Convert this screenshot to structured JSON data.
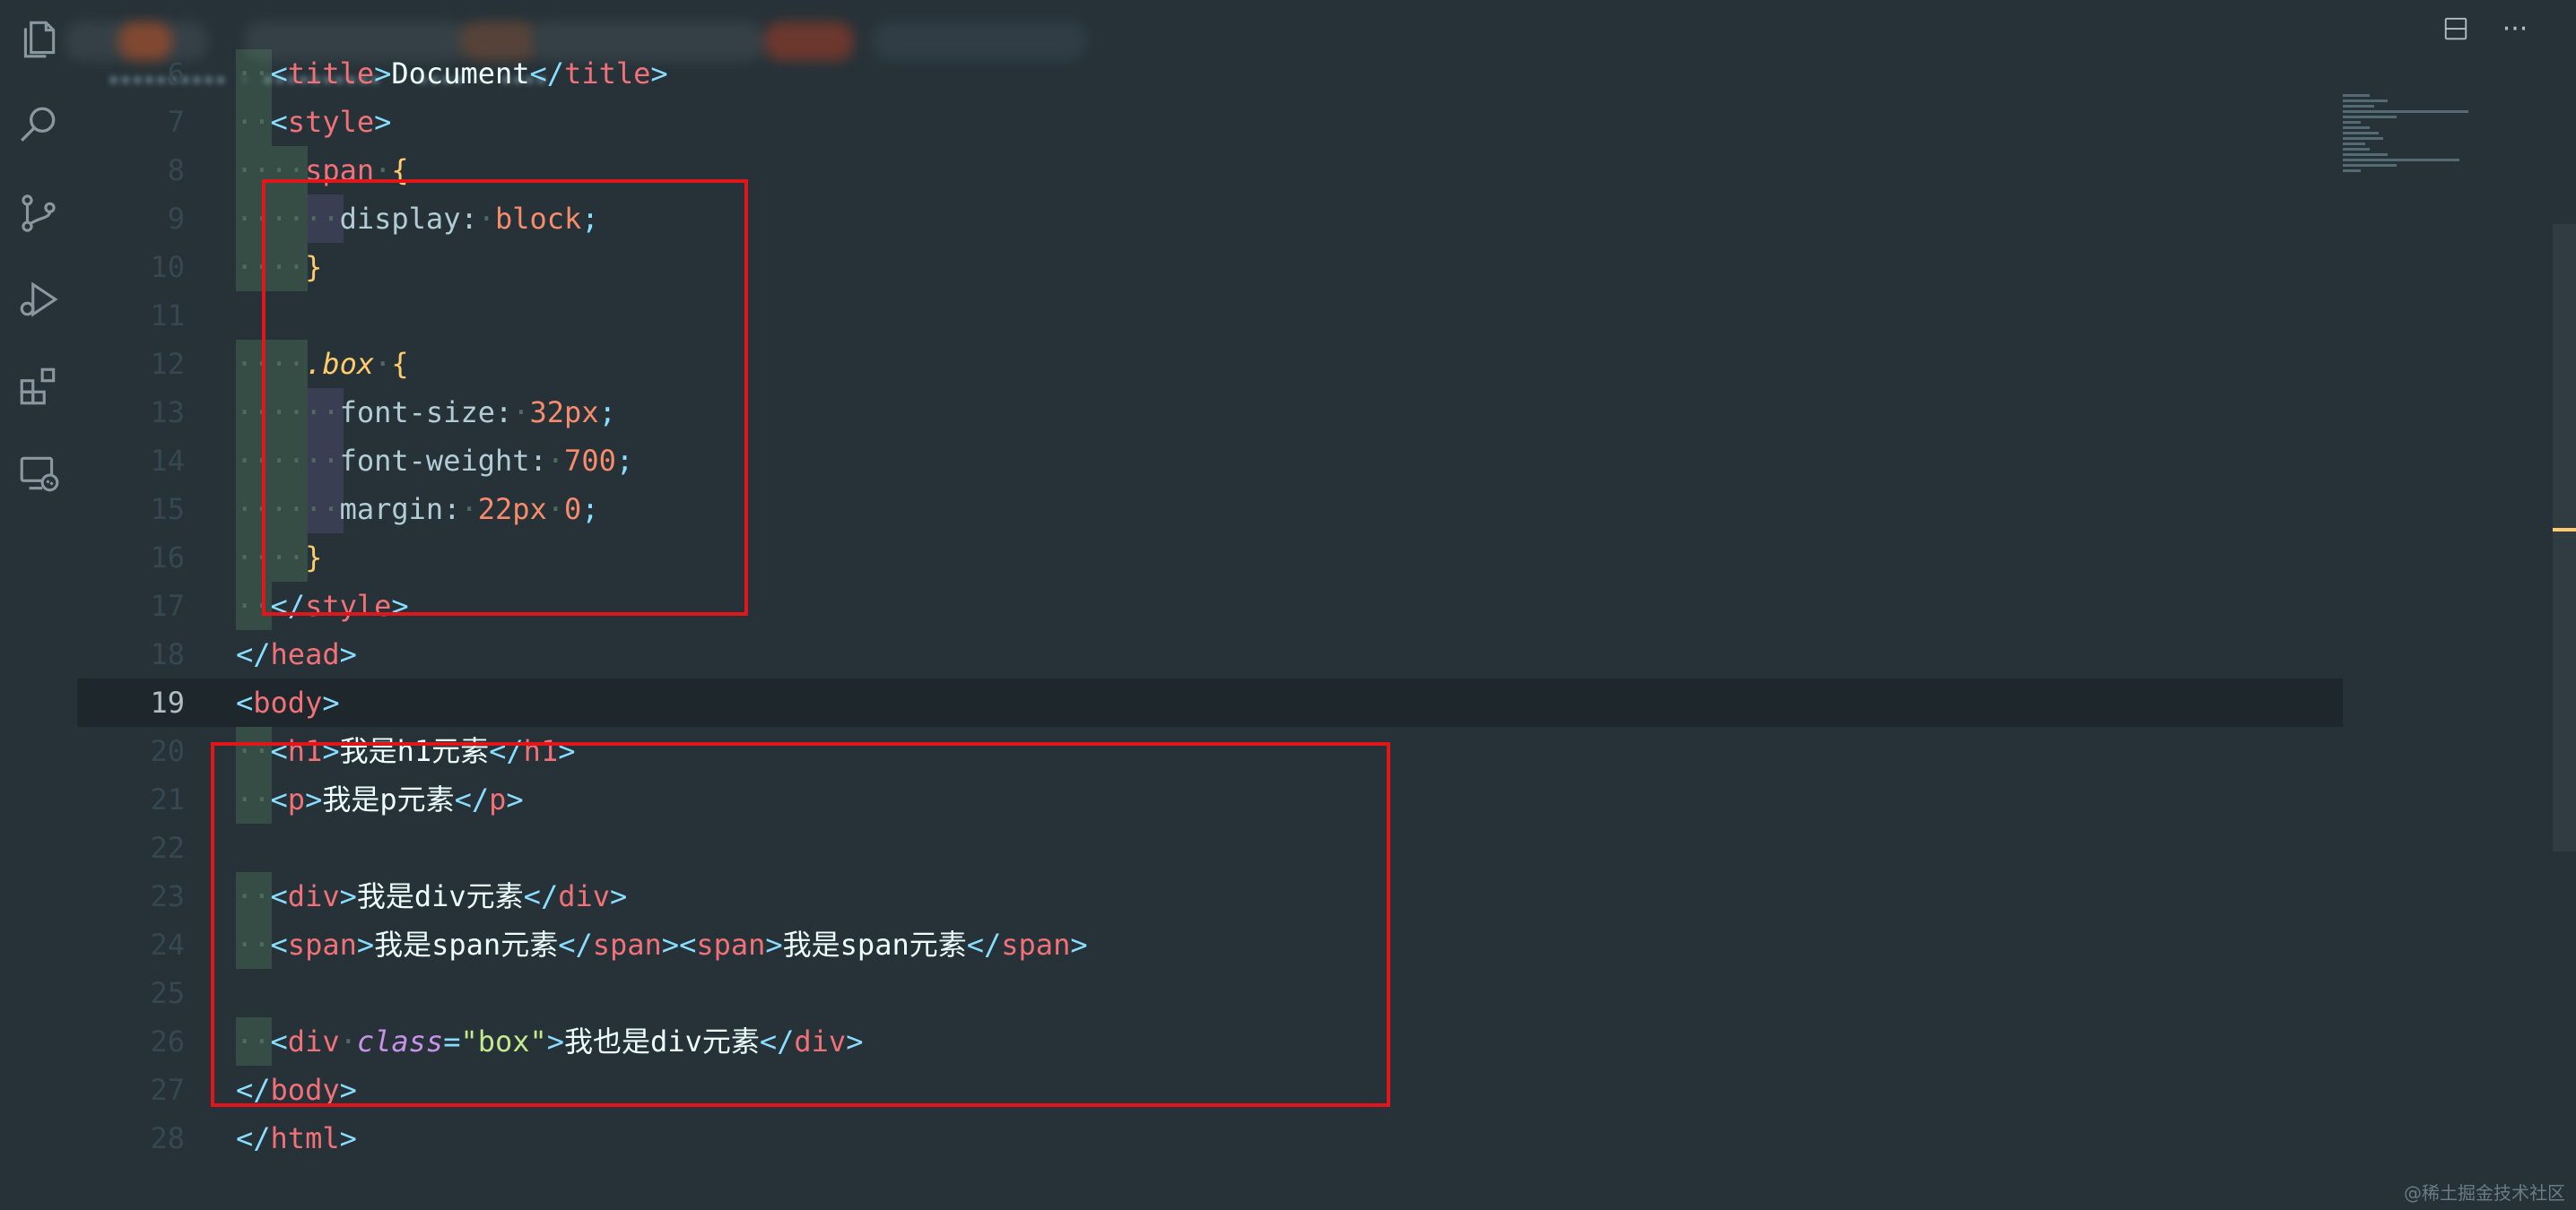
{
  "activity_bar": {
    "icons": [
      "explorer-icon",
      "search-icon",
      "source-control-icon",
      "run-debug-icon",
      "extensions-icon",
      "remote-explorer-icon"
    ]
  },
  "top_actions": {
    "split_editor": "⊟",
    "more": "···"
  },
  "editor": {
    "current_line": 19,
    "lines": [
      {
        "n": "6"
      },
      {
        "n": "7"
      },
      {
        "n": "8"
      },
      {
        "n": "9"
      },
      {
        "n": "10"
      },
      {
        "n": "11"
      },
      {
        "n": "12"
      },
      {
        "n": "13"
      },
      {
        "n": "14"
      },
      {
        "n": "15"
      },
      {
        "n": "16"
      },
      {
        "n": "17"
      },
      {
        "n": "18"
      },
      {
        "n": "19"
      },
      {
        "n": "20"
      },
      {
        "n": "21"
      },
      {
        "n": "22"
      },
      {
        "n": "23"
      },
      {
        "n": "24"
      },
      {
        "n": "25"
      },
      {
        "n": "26"
      },
      {
        "n": "27"
      },
      {
        "n": "28"
      }
    ],
    "code": {
      "l6_tag": "title",
      "l6_text": "Document",
      "l7_tag": "style",
      "l8_sel": "span",
      "l8_brace": "{",
      "l9_prop": "display:",
      "l9_val": "block",
      "l10_brace": "}",
      "l12_sel": ".box",
      "l12_brace": "{",
      "l13_prop": "font-size:",
      "l13_val": "32px",
      "l14_prop": "font-weight:",
      "l14_val": "700",
      "l15_prop": "margin:",
      "l15_val1": "22px",
      "l15_val2": "0",
      "l16_brace": "}",
      "l17_tag": "style",
      "l18_tag": "head",
      "l19_tag": "body",
      "l20_tag": "h1",
      "l20_text": "我是h1元素",
      "l21_tag": "p",
      "l21_text": "我是p元素",
      "l23_tag": "div",
      "l23_text": "我是div元素",
      "l24_tag": "span",
      "l24_text1": "我是span元素",
      "l24_text2": "我是span元素",
      "l26_tag": "div",
      "l26_attr": "class",
      "l26_str": "\"box\"",
      "l26_text": "我也是div元素",
      "l27_tag": "body",
      "l28_tag": "html"
    }
  },
  "watermark": "@稀土掘金技术社区",
  "colors": {
    "background": "#263238",
    "highlight_box": "#e0161a",
    "tag": "#f07178",
    "punctuation": "#89ddff",
    "number": "#f78c6c",
    "string": "#c3e88d",
    "attribute": "#c792ea",
    "class_selector": "#ffcb6b"
  }
}
